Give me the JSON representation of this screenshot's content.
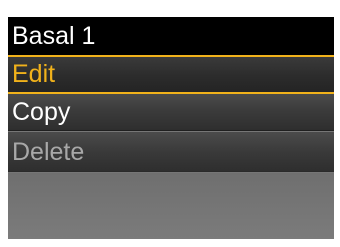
{
  "screen": {
    "title": "Basal 1"
  },
  "menu": {
    "items": [
      {
        "label": "Edit",
        "state": "selected",
        "color": "#f1b21b"
      },
      {
        "label": "Copy",
        "state": "normal",
        "color": "#ffffff"
      },
      {
        "label": "Delete",
        "state": "disabled",
        "color": "#a8a8a8"
      }
    ]
  }
}
